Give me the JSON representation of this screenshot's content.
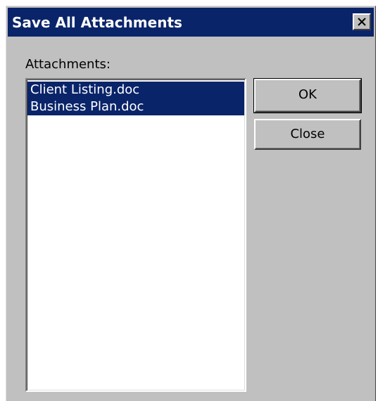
{
  "window": {
    "title": "Save All Attachments",
    "close_icon": "close-icon"
  },
  "attachments": {
    "label": "Attachments:",
    "items": [
      {
        "name": "Client Listing.doc",
        "selected": true
      },
      {
        "name": "Business Plan.doc",
        "selected": true
      }
    ]
  },
  "buttons": {
    "ok_label": "OK",
    "close_label": "Close"
  },
  "colors": {
    "titlebar": "#0a246a",
    "selection": "#0a246a",
    "dialog_face": "#c0c0c0"
  }
}
